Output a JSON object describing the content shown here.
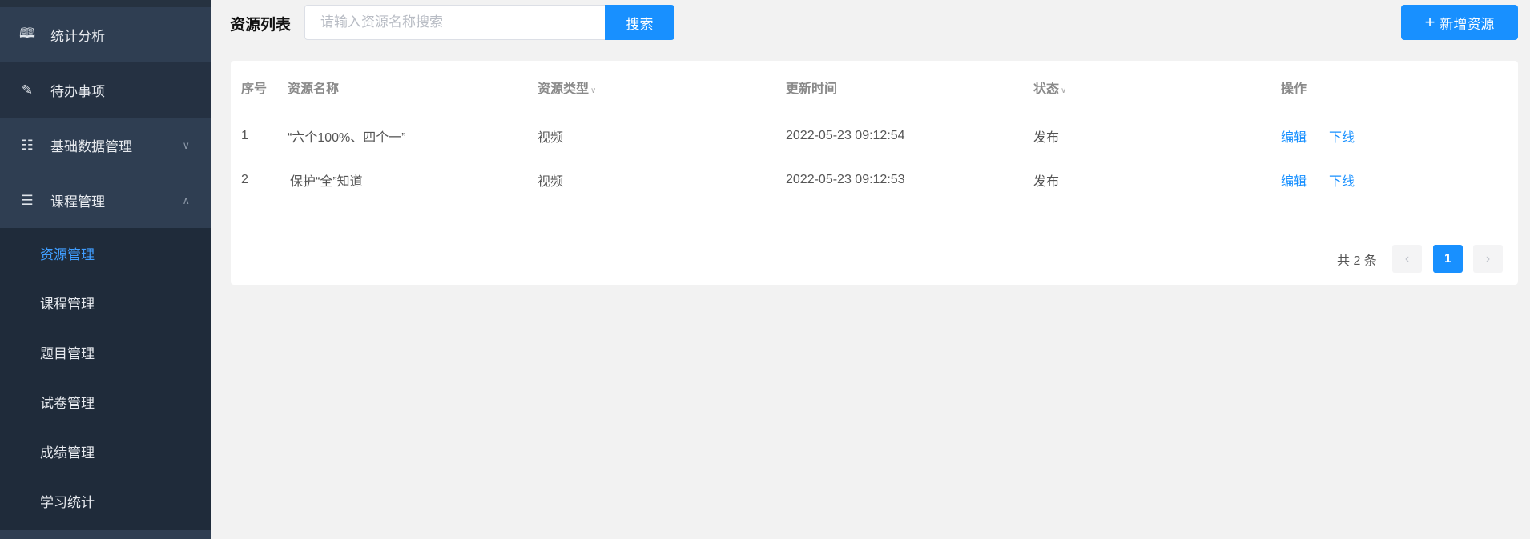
{
  "sidebar": {
    "menu": [
      {
        "label": "统计分析",
        "icon": "book-icon"
      },
      {
        "label": "待办事项",
        "icon": "document-edit-icon"
      },
      {
        "label": "基础数据管理",
        "icon": "sitemap-icon"
      },
      {
        "label": "课程管理",
        "icon": "list-icon"
      }
    ],
    "submenu": [
      "资源管理",
      "课程管理",
      "题目管理",
      "试卷管理",
      "成绩管理",
      "学习统计"
    ]
  },
  "header": {
    "title": "资源列表",
    "search_placeholder": "请输入资源名称搜索",
    "search_value": "",
    "search_label": "搜索",
    "add_label": "新增资源",
    "accent": "#1890ff"
  },
  "table": {
    "columns": [
      "序号",
      "资源名称",
      "资源类型",
      "更新时间",
      "状态",
      "操作"
    ],
    "rows": [
      {
        "index": "1",
        "name": "“六个100%、四个一”",
        "type": "视频",
        "updated": "2022-05-23 09:12:54",
        "status": "发布",
        "edit": "编辑",
        "offline": "下线"
      },
      {
        "index": "2",
        "name": "保护“全”知道",
        "type": "视频",
        "updated": "2022-05-23 09:12:53",
        "status": "发布",
        "edit": "编辑",
        "offline": "下线"
      }
    ]
  },
  "pagination": {
    "total": "共 2 条",
    "current": "1"
  }
}
